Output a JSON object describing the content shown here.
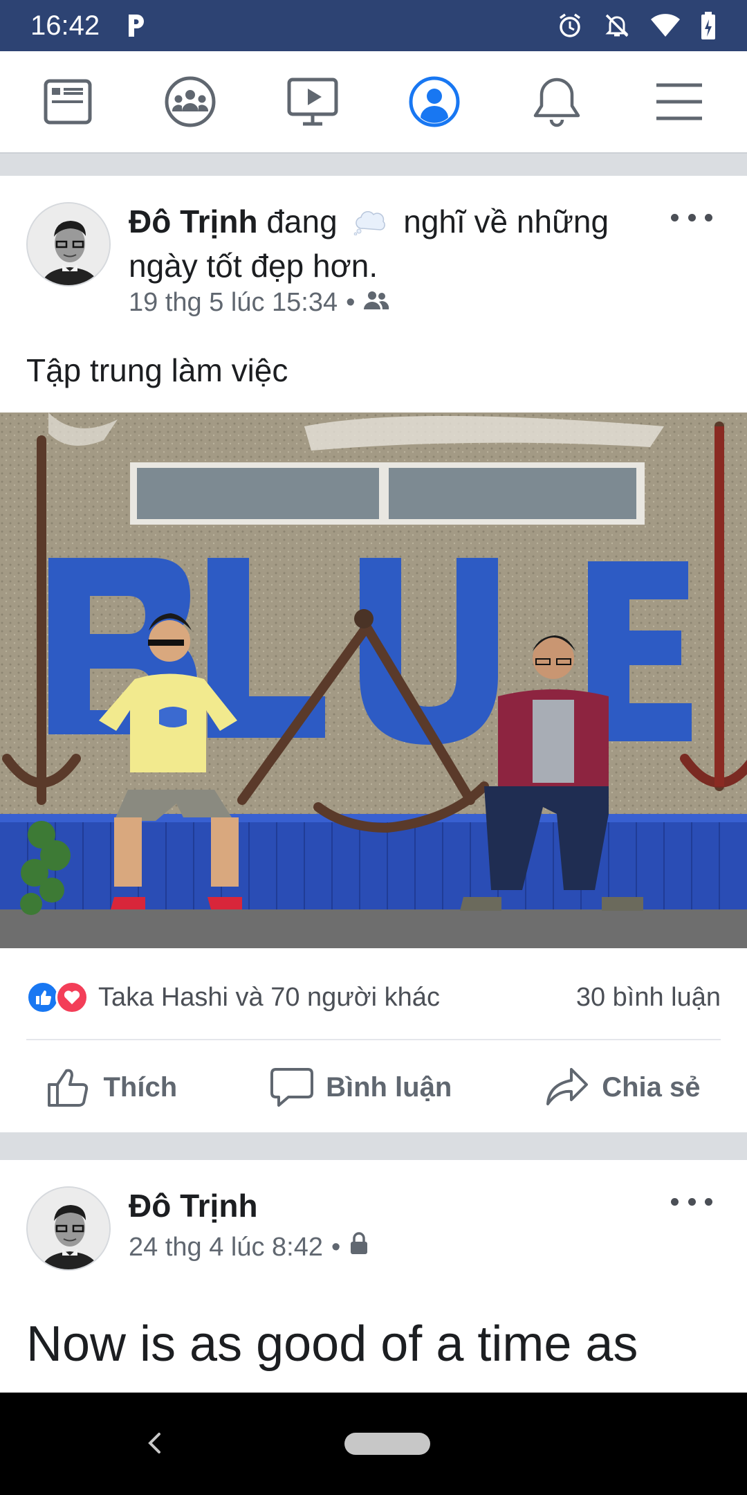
{
  "status_bar": {
    "time": "16:42",
    "app_icon": "p-icon"
  },
  "top_nav": {
    "items": [
      {
        "name": "news-feed-icon",
        "active": false
      },
      {
        "name": "groups-icon",
        "active": false
      },
      {
        "name": "watch-icon",
        "active": false
      },
      {
        "name": "profile-icon",
        "active": true
      },
      {
        "name": "notifications-icon",
        "active": false
      },
      {
        "name": "menu-icon",
        "active": false
      }
    ]
  },
  "posts": [
    {
      "author": "Đô Trịnh",
      "header_before": "đang",
      "activity_icon": "thought-bubble-icon",
      "header_after": "nghĩ về những ngày tốt đẹp hơn.",
      "timestamp": "19 thg 5 lúc 15:34",
      "audience_icon": "friends-icon",
      "text": "Tập trung làm việc",
      "reactions_text": "Taka Hashi và 70 người khác",
      "comments_text": "30 bình luận",
      "actions": {
        "like": "Thích",
        "comment": "Bình luận",
        "share": "Chia sẻ"
      }
    },
    {
      "author": "Đô Trịnh",
      "timestamp": "24 thg 4 lúc 8:42",
      "audience_icon": "lock-icon",
      "text": "Now is as good of a time as"
    }
  ],
  "colors": {
    "brand": "#4267b2",
    "status_bar": "#2d4373",
    "like_blue": "#1877f2",
    "love_red": "#f33e58"
  }
}
